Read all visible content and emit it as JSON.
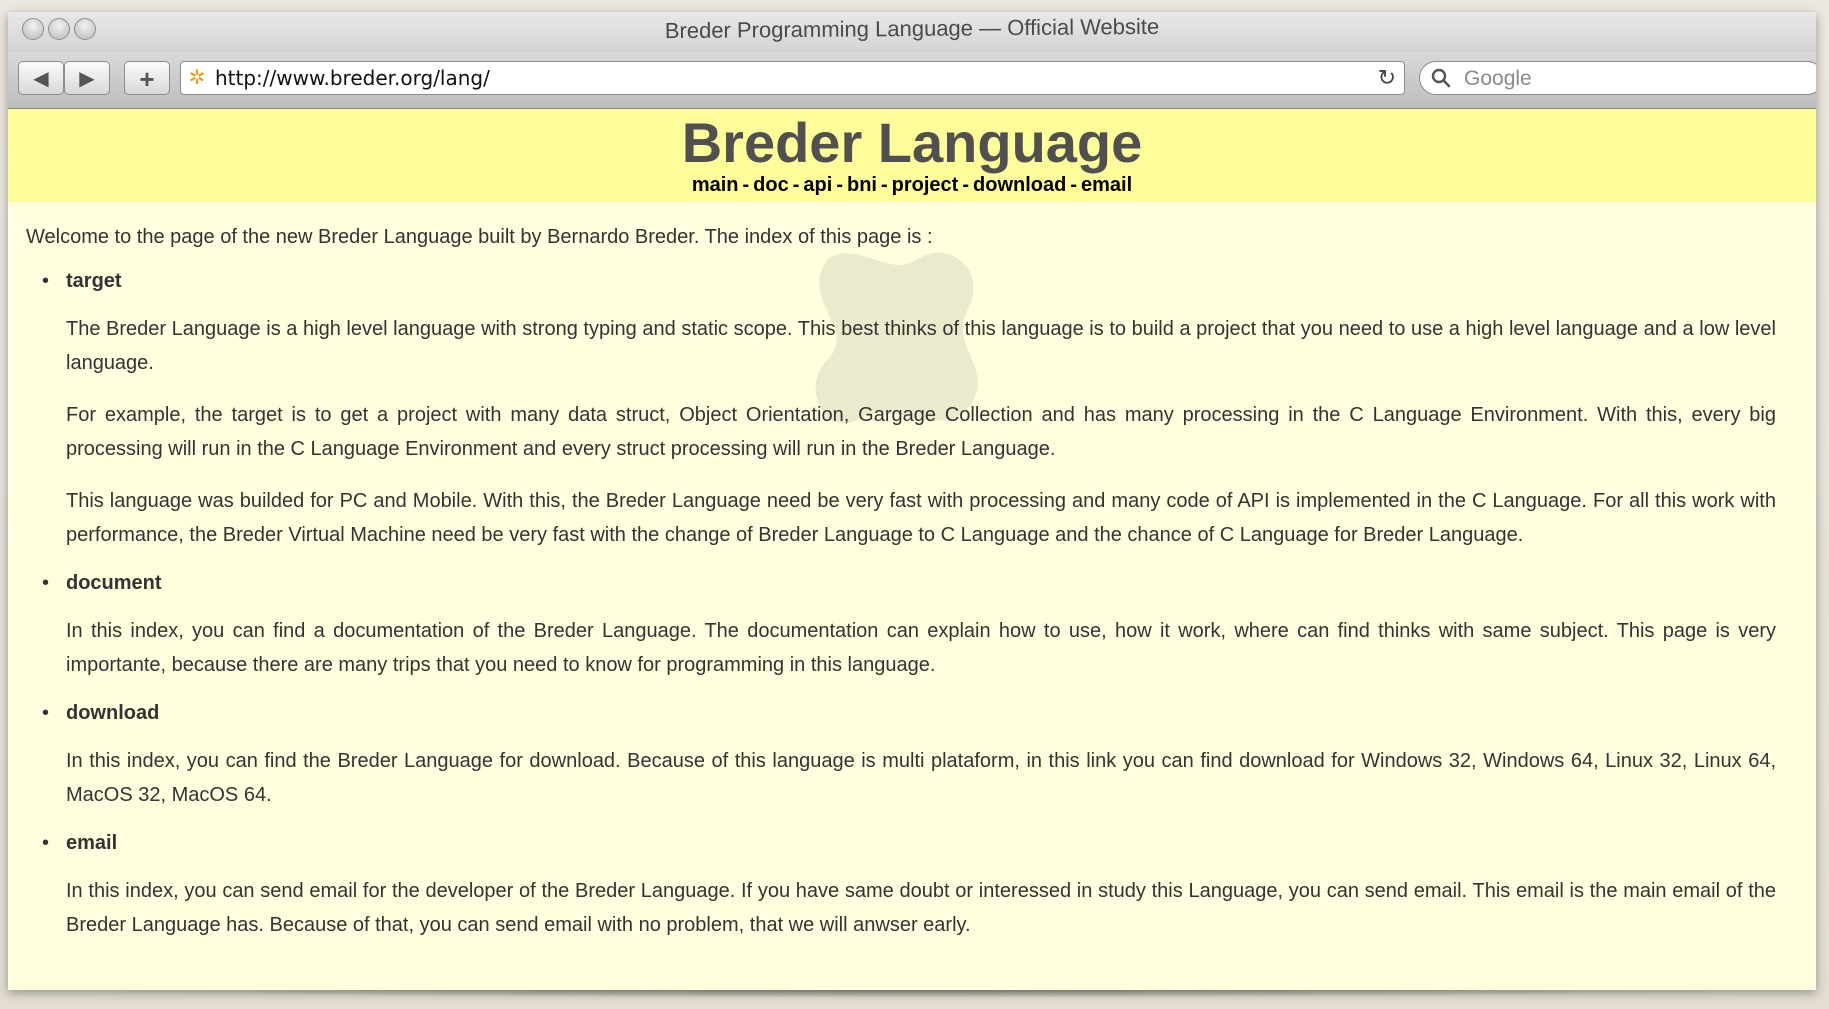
{
  "window": {
    "title": "Breder Programming Language — Official Website"
  },
  "toolbar": {
    "back_glyph": "◀",
    "forward_glyph": "▶",
    "add_glyph": "+",
    "url": "http://www.breder.org/lang/",
    "reload_glyph": "↻",
    "search_placeholder": "Google"
  },
  "icons": {
    "back": "back-arrow-icon",
    "forward": "forward-arrow-icon",
    "add": "plus-icon",
    "favicon": "site-favicon-icon",
    "reload": "reload-icon",
    "search": "search-icon"
  },
  "header": {
    "title": "Breder Language",
    "nav": [
      {
        "label": "main"
      },
      {
        "label": "doc"
      },
      {
        "label": "api"
      },
      {
        "label": "bni"
      },
      {
        "label": "project"
      },
      {
        "label": "download"
      },
      {
        "label": "email"
      }
    ],
    "separator": "-"
  },
  "content": {
    "intro": "Welcome to the page of the new Breder Language built by Bernardo Breder. The index of this page is :",
    "sections": [
      {
        "heading": "target",
        "paragraphs": [
          "The Breder Language is a high level language with strong typing and static scope. This best thinks of this language is to build a project that you need to use a high level language and a low level language.",
          "For example, the target is to get a project with many data struct, Object Orientation, Gargage Collection and has many processing in the C Language Environment. With this, every big processing will run in the C Language Environment and every struct processing will run in the Breder Language.",
          "This language was builded for PC and Mobile. With this, the Breder Language need be very fast with processing and many code of API is implemented in the C Language. For all this work with performance, the Breder Virtual Machine need be very fast with the change of Breder Language to C Language and the chance of C Language for Breder Language."
        ]
      },
      {
        "heading": "document",
        "paragraphs": [
          "In this index, you can find a documentation of the Breder Language. The documentation can explain how to use, how it work, where can find thinks with same subject. This page is very importante, because there are many trips that you need to know for programming in this language."
        ]
      },
      {
        "heading": "download",
        "paragraphs": [
          "In this index, you can find the Breder Language for download. Because of this language is multi plataform, in this link you can find download for Windows 32, Windows 64, Linux 32, Linux 64, MacOS 32, MacOS 64."
        ]
      },
      {
        "heading": "email",
        "paragraphs": [
          "In this index, you can send email for the developer of the Breder Language. If you have same doubt or interessed in study this Language, you can send email. This email is the main email of the Breder Language has. Because of that, you can send email with no problem, that we will anwser early."
        ]
      }
    ]
  },
  "colors": {
    "header_background": "#fffc9a",
    "page_background": "#ffffe0",
    "title_color": "#505050",
    "text_color": "#333333"
  }
}
